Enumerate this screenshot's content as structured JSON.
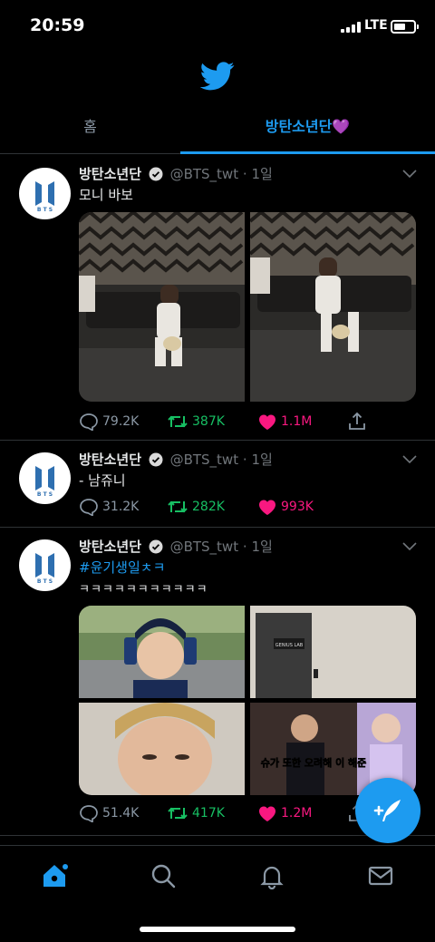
{
  "status_bar": {
    "time": "20:59",
    "network": "LTE"
  },
  "colors": {
    "accent": "#1d9bf0",
    "retweet": "#17bf63",
    "like": "#f91880",
    "divider": "#2f3336"
  },
  "header": {
    "logo_icon": "twitter-bird-icon"
  },
  "tabs": [
    {
      "label": "홈",
      "active": false
    },
    {
      "label": "방탄소년단💜",
      "active": true
    }
  ],
  "tweets": [
    {
      "name": "방탄소년단",
      "handle": "@BTS_twt",
      "time": "1일",
      "text": "모니 바보",
      "replies": "79.2K",
      "retweets": "387K",
      "likes": "1.1M"
    },
    {
      "name": "방탄소년단",
      "handle": "@BTS_twt",
      "time": "1일",
      "text": "- 남쥬니",
      "replies": "31.2K",
      "retweets": "282K",
      "likes": "993K"
    },
    {
      "name": "방탄소년단",
      "handle": "@BTS_twt",
      "time": "1일",
      "hashtag": "#윤기생일ㅊㅋ",
      "text": "ㅋㅋㅋㅋㅋㅋㅋㅋㅋㅋㅋ",
      "replies": "51.4K",
      "retweets": "417K",
      "likes": "1.2M",
      "photo_captions": {
        "door_sign": "GENIUS LAB",
        "tv_caption": "슈가 또한 오려해 이 해준"
      }
    }
  ],
  "bottom_nav": [
    {
      "icon": "home-icon",
      "active": true
    },
    {
      "icon": "search-icon",
      "active": false
    },
    {
      "icon": "bell-icon",
      "active": false
    },
    {
      "icon": "mail-icon",
      "active": false
    }
  ],
  "fab": {
    "icon": "compose-tweet-icon"
  }
}
